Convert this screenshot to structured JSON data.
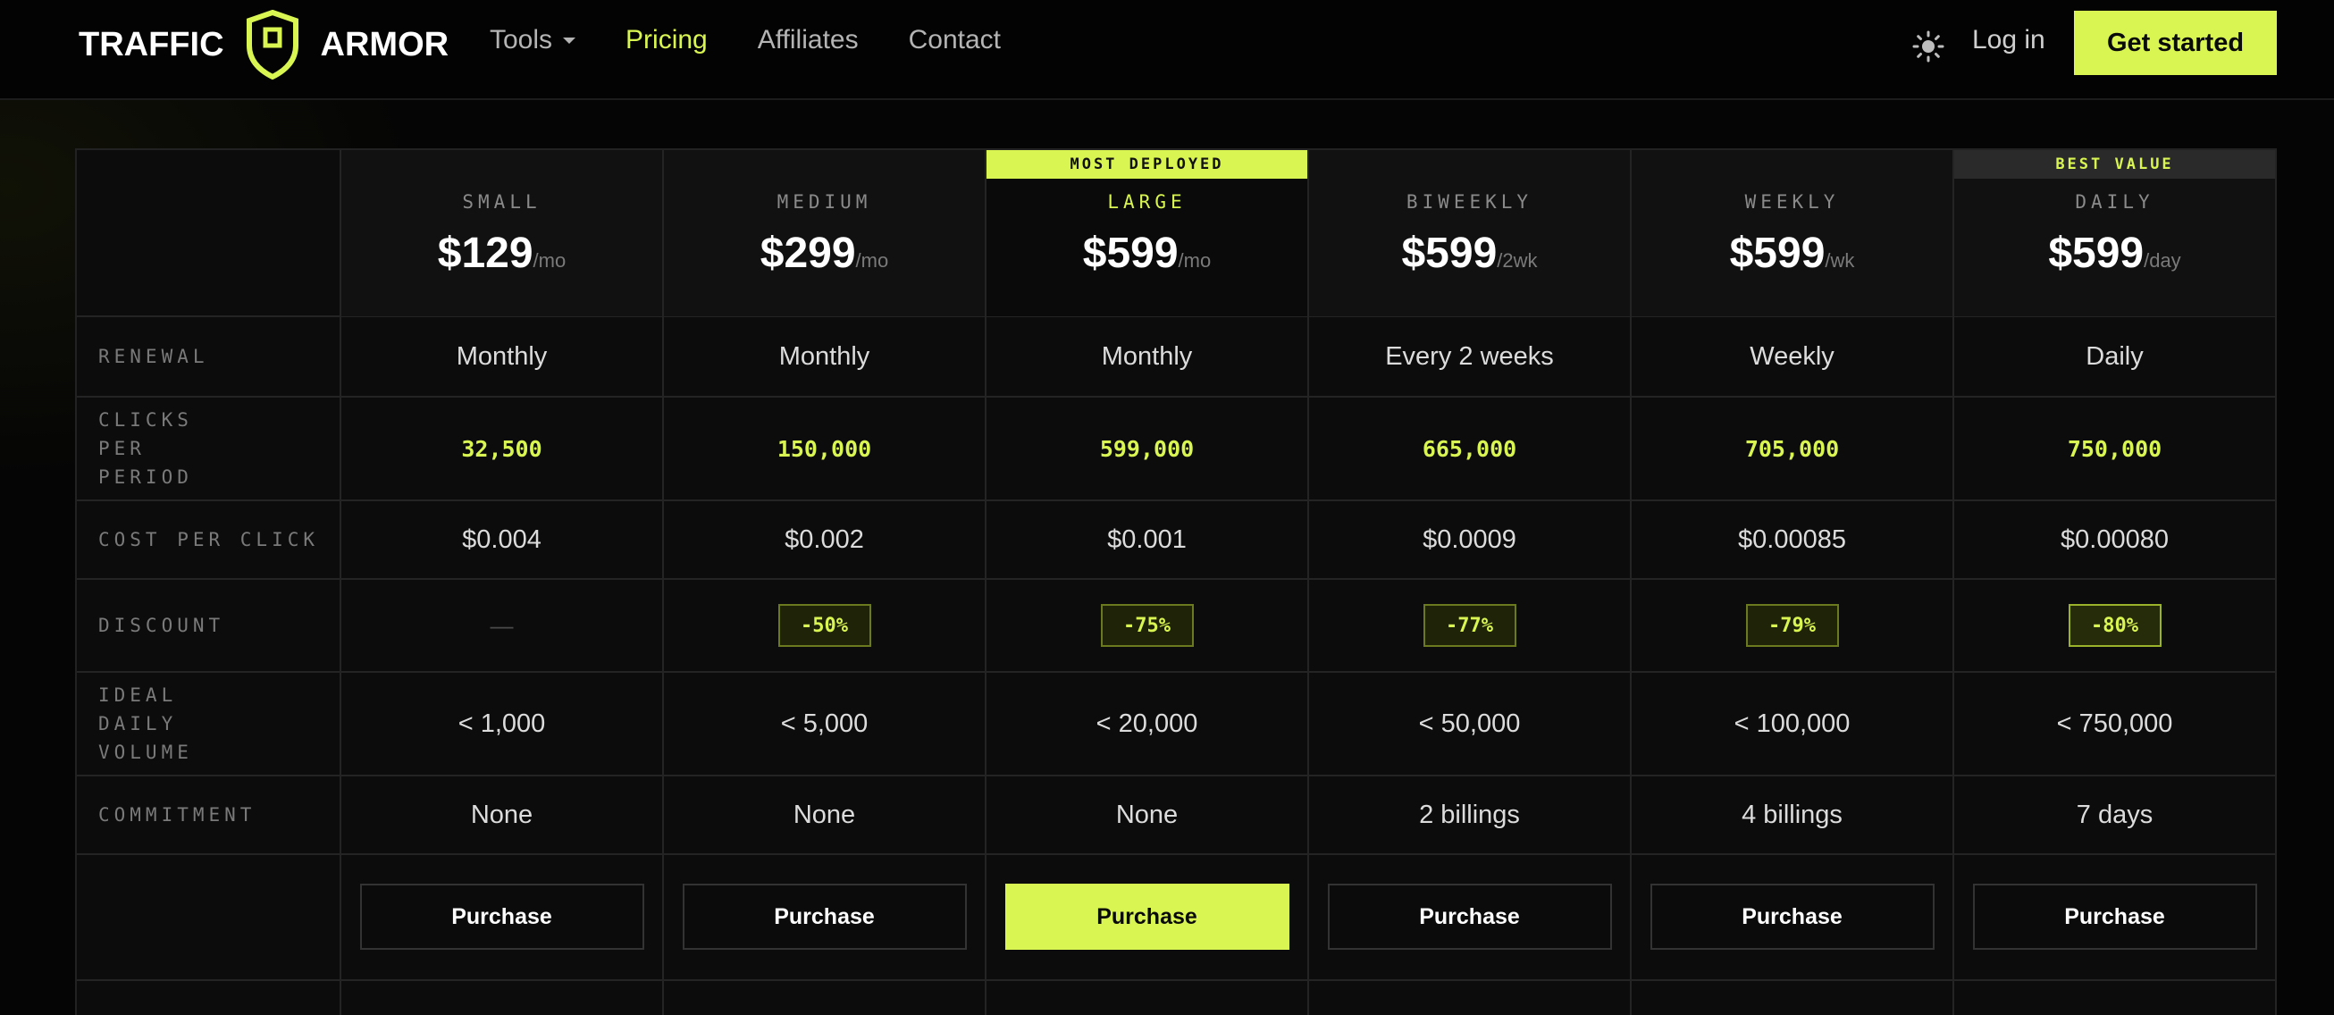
{
  "brand": {
    "word_left": "TRAFFIC",
    "word_right": "ARMOR",
    "accent": "#d9f552"
  },
  "nav": {
    "links": [
      {
        "label": "Tools",
        "has_dropdown": true
      },
      {
        "label": "Pricing",
        "active": true
      },
      {
        "label": "Affiliates"
      },
      {
        "label": "Contact"
      }
    ],
    "theme_icon": "sun-icon",
    "login_label": "Log in",
    "cta_label": "Get started"
  },
  "plans": [
    {
      "name": "SMALL",
      "price": "$129",
      "period": "/mo",
      "tag": "",
      "renewal": "Monthly",
      "clicks": "32,500",
      "cpc": "$0.004",
      "discount": "—",
      "volume": "< 1,000",
      "commitment": "None",
      "button": "Purchase"
    },
    {
      "name": "MEDIUM",
      "price": "$299",
      "period": "/mo",
      "tag": "",
      "renewal": "Monthly",
      "clicks": "150,000",
      "cpc": "$0.002",
      "discount": "-50%",
      "volume": "< 5,000",
      "commitment": "None",
      "button": "Purchase"
    },
    {
      "name": "LARGE",
      "price": "$599",
      "period": "/mo",
      "tag": "MOST DEPLOYED",
      "renewal": "Monthly",
      "clicks": "599,000",
      "cpc": "$0.001",
      "discount": "-75%",
      "volume": "< 20,000",
      "commitment": "None",
      "button": "Purchase"
    },
    {
      "name": "BIWEEKLY",
      "price": "$599",
      "period": "/2wk",
      "tag": "",
      "renewal": "Every 2 weeks",
      "clicks": "665,000",
      "cpc": "$0.0009",
      "discount": "-77%",
      "volume": "< 50,000",
      "commitment": "2 billings",
      "button": "Purchase"
    },
    {
      "name": "WEEKLY",
      "price": "$599",
      "period": "/wk",
      "tag": "",
      "renewal": "Weekly",
      "clicks": "705,000",
      "cpc": "$0.00085",
      "discount": "-79%",
      "volume": "< 100,000",
      "commitment": "4 billings",
      "button": "Purchase"
    },
    {
      "name": "DAILY",
      "price": "$599",
      "period": "/day",
      "tag": "BEST VALUE",
      "renewal": "Daily",
      "clicks": "750,000",
      "cpc": "$0.00080",
      "discount": "-80%",
      "volume": "< 750,000",
      "commitment": "7 days",
      "button": "Purchase"
    }
  ],
  "rows": {
    "renewal": "RENEWAL",
    "clicks": "CLICKS PER PERIOD",
    "cpc": "COST PER CLICK",
    "discount": "DISCOUNT",
    "volume": "IDEAL DAILY VOLUME",
    "commitment": "COMMITMENT"
  }
}
